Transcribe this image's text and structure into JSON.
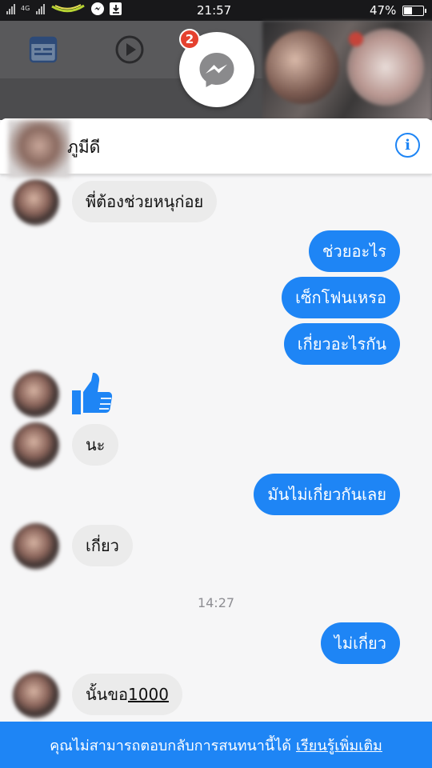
{
  "status_bar": {
    "time": "21:57",
    "battery_percent": "47%",
    "battery_level": 0.47,
    "network_label": "4G"
  },
  "chat_head": {
    "badge_count": "2",
    "icon": "messenger-icon"
  },
  "conversation": {
    "contact_name": "ภูมีดี",
    "info_icon": "info-icon",
    "timestamp": "14:27",
    "messages": [
      {
        "from": "contact",
        "text": "พี่ต้องช่วยหนุก่อย"
      },
      {
        "from": "me",
        "text": "ช่วยอะไร"
      },
      {
        "from": "me",
        "text": "เซ็กโฟนเหรอ"
      },
      {
        "from": "me",
        "text": "เกี่ยวอะไรกัน"
      },
      {
        "from": "contact",
        "type": "like",
        "icon": "thumbs-up-icon"
      },
      {
        "from": "contact",
        "text": "นะ"
      },
      {
        "from": "me",
        "text": "มันไม่เกี่ยวกันเลย"
      },
      {
        "from": "contact",
        "text": "เกี่ยว"
      },
      {
        "from": "me",
        "text": "ไม่เกี่ยว"
      },
      {
        "from": "contact",
        "text_prefix": "นั้นขอ",
        "text_link": "1000"
      }
    ]
  },
  "footer": {
    "notice": "คุณไม่สามารถตอบกลับการสนทนานี้ได้",
    "learn_more": "เรียนรู้เพิ่มเติม"
  },
  "colors": {
    "accent": "#1e85f5",
    "incoming_bubble": "#ebebeb",
    "badge": "#e5412f"
  }
}
